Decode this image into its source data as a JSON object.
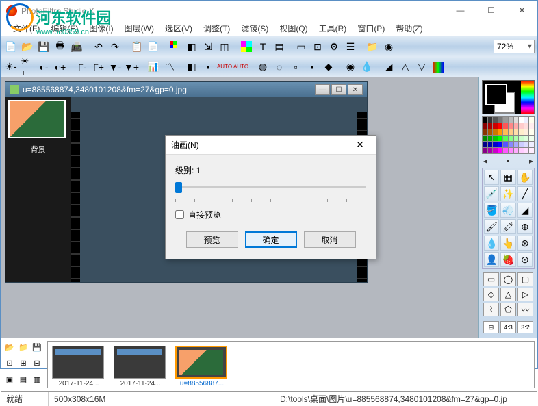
{
  "app": {
    "title": "PhotoFiltre Studio X"
  },
  "watermark": {
    "text": "河东软件园",
    "url": "www.pc0359.cn"
  },
  "window_controls": {
    "min": "—",
    "max": "☐",
    "close": "✕"
  },
  "menu": [
    "文件(F)",
    "编辑(E)",
    "图像(I)",
    "图层(W)",
    "选区(V)",
    "调整(T)",
    "滤镜(S)",
    "视图(Q)",
    "工具(R)",
    "窗口(P)",
    "帮助(Z)"
  ],
  "zoom": "72%",
  "document": {
    "title": "u=885568874,3480101208&fm=27&gp=0.jpg",
    "layer_label": "背景"
  },
  "dialog": {
    "title": "油画(N)",
    "level_label": "级别:",
    "level_value": "1",
    "preview_checkbox": "直接预览",
    "btn_preview": "预览",
    "btn_ok": "确定",
    "btn_cancel": "取消"
  },
  "palette_colors": [
    "#000",
    "#333",
    "#555",
    "#777",
    "#999",
    "#bbb",
    "#ddd",
    "#fff",
    "#eef",
    "#ffe",
    "#800",
    "#a00",
    "#c00",
    "#f00",
    "#f55",
    "#f88",
    "#faa",
    "#fcc",
    "#fdd",
    "#fee",
    "#830",
    "#a50",
    "#c70",
    "#f90",
    "#fb5",
    "#fc8",
    "#fda",
    "#fec",
    "#fed",
    "#ffe",
    "#080",
    "#0a0",
    "#0c0",
    "#0f0",
    "#5f5",
    "#8f8",
    "#afa",
    "#cfc",
    "#dfd",
    "#efe",
    "#008",
    "#00a",
    "#00c",
    "#00f",
    "#55f",
    "#88f",
    "#aaf",
    "#ccf",
    "#ddf",
    "#eef",
    "#808",
    "#a0a",
    "#c0c",
    "#f0f",
    "#f5f",
    "#f8f",
    "#faf",
    "#fcf",
    "#fdf",
    "#fef"
  ],
  "thumbnails": [
    {
      "name": "2017-11-24...",
      "selected": false
    },
    {
      "name": "2017-11-24...",
      "selected": false
    },
    {
      "name": "u=88556887...",
      "selected": true
    }
  ],
  "ratios": [
    "⊞",
    "4:3",
    "3:2"
  ],
  "status": {
    "ready": "就绪",
    "dims": "500x308x16M",
    "path": "D:\\tools\\桌面\\图片\\u=885568874,3480101208&fm=27&gp=0.jp"
  }
}
